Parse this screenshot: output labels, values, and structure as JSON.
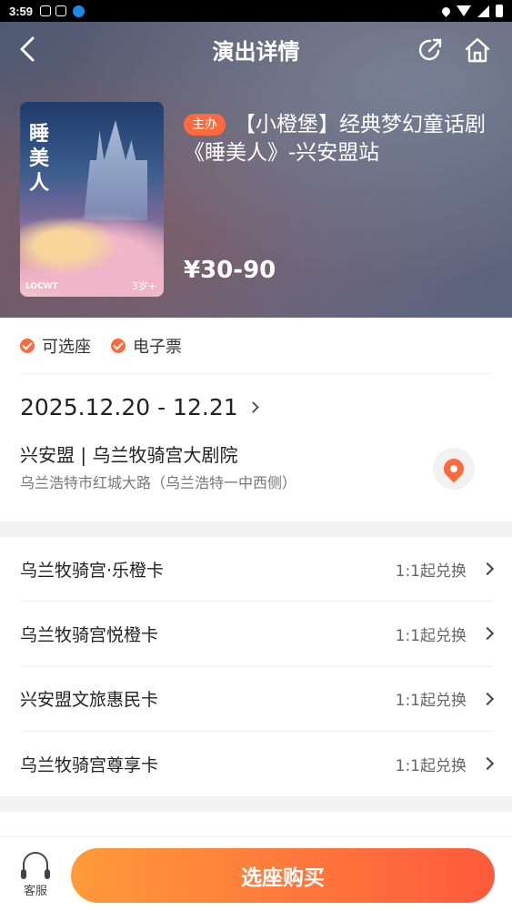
{
  "status_bar": {
    "time": "3:59"
  },
  "nav": {
    "title": "演出详情"
  },
  "show": {
    "tag": "主办",
    "title": "【小橙堡】经典梦幻童话剧《睡美人》-兴安盟站",
    "price": "¥30-90",
    "poster_title": "睡美人",
    "poster_brand": "LOCWT",
    "poster_age": "3岁+"
  },
  "features": [
    "可选座",
    "电子票"
  ],
  "date": "2025.12.20 - 12.21",
  "venue": {
    "name": "兴安盟 | 乌兰牧骑宫大剧院",
    "address": "乌兰浩特市红城大路（乌兰浩特一中西侧）"
  },
  "cards": [
    {
      "name": "乌兰牧骑宫·乐橙卡",
      "exchange": "1:1起兑换"
    },
    {
      "name": "乌兰牧骑宫悦橙卡",
      "exchange": "1:1起兑换"
    },
    {
      "name": "兴安盟文旅惠民卡",
      "exchange": "1:1起兑换"
    },
    {
      "name": "乌兰牧骑宫尊享卡",
      "exchange": "1:1起兑换"
    }
  ],
  "bottom_bar": {
    "service_label": "客服",
    "buy_label": "选座购买"
  },
  "colors": {
    "accent": "#ff6a3d",
    "buy_gradient_start": "#ff9a3a",
    "buy_gradient_end": "#ff5a3c"
  },
  "icons": [
    "back-icon",
    "share-icon",
    "home-icon",
    "map-pin-icon",
    "customer-service-icon",
    "check-icon",
    "chevron-right-icon"
  ]
}
